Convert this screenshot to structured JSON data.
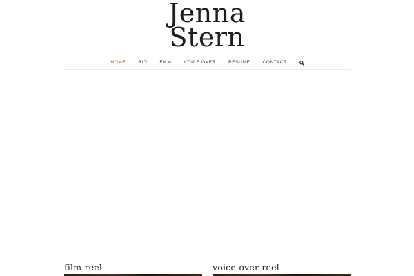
{
  "site": {
    "title_line1": "Jenna",
    "title_line2": "Stern"
  },
  "nav": {
    "items": [
      {
        "label": "HOME",
        "active": true
      },
      {
        "label": "BIO",
        "active": false
      },
      {
        "label": "FILM",
        "active": false
      },
      {
        "label": "VOICE OVER",
        "active": false
      },
      {
        "label": "RESUME",
        "active": false
      },
      {
        "label": "CONTACT",
        "active": false
      }
    ],
    "search_icon": "search-icon"
  },
  "reels": {
    "film": {
      "title": "film reel"
    },
    "voice": {
      "title": "voice-over reel"
    }
  },
  "colors": {
    "accent": "#b5533c",
    "text": "#333333",
    "divider": "#ececec"
  }
}
